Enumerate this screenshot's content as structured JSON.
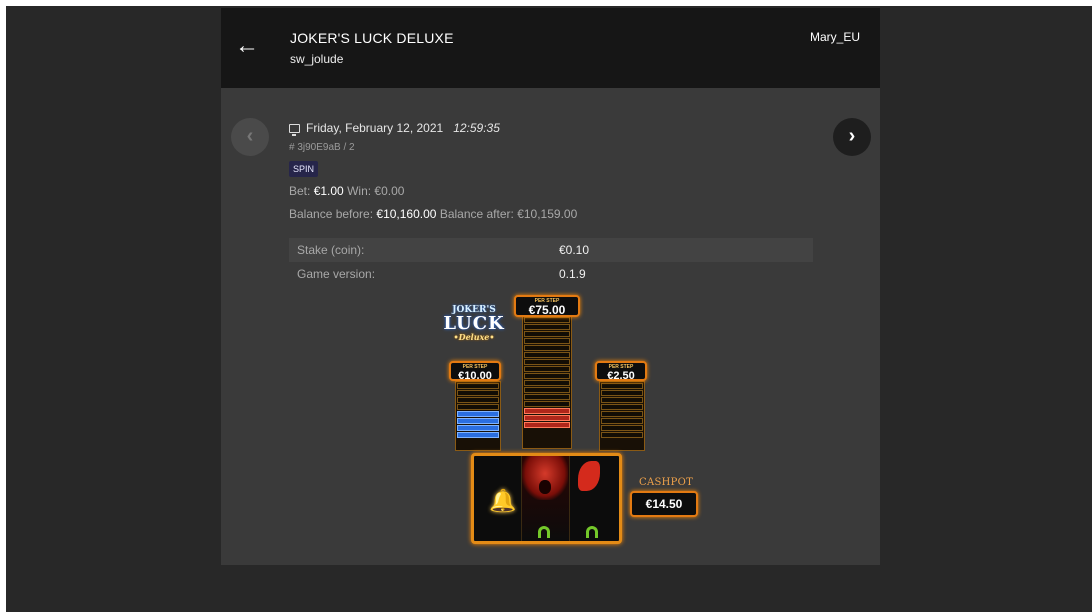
{
  "header": {
    "back_label": "←",
    "game_title": "JOKER'S LUCK DELUXE",
    "game_code": "sw_jolude",
    "user": "Mary_EU"
  },
  "navigation": {
    "prev_label": "‹",
    "next_label": "›"
  },
  "round": {
    "date": "Friday, February 12, 2021",
    "time": "12:59:35",
    "id": "# 3j90E9aB / 2",
    "type_badge": "SPIN",
    "bet_label": "Bet:",
    "bet_value": "€1.00",
    "win_label": "Win:",
    "win_value": "€0.00",
    "balance_before_label": "Balance before:",
    "balance_before": "€10,160.00",
    "balance_after_label": "Balance after:",
    "balance_after": "€10,159.00"
  },
  "details": [
    {
      "key": "Stake (coin):",
      "value": "€0.10"
    },
    {
      "key": "Game version:",
      "value": "0.1.9"
    }
  ],
  "game_art": {
    "logo_line1": "JOKER'S",
    "logo_line2": "LUCK",
    "logo_line3": "•Deluxe•",
    "per_step_label": "PER STEP",
    "tower_left_value": "€10.00",
    "tower_middle_value": "€75.00",
    "tower_right_value": "€2.50",
    "cashpot_label": "CASHPOT",
    "cashpot_value": "€14.50",
    "reel_symbols": [
      "bell-icon",
      "joker-icon",
      "horseshoe-icon"
    ]
  },
  "colors": {
    "background": "#282828",
    "header_bg": "#161616",
    "panel_bg": "#3a3a3a",
    "badge_bg": "#26254a",
    "accent_orange": "#e37a12"
  }
}
